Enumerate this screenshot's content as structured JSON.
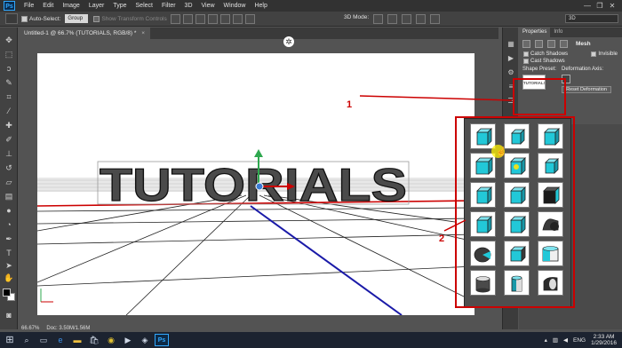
{
  "app": {
    "logo_text": "Ps",
    "menu": [
      "File",
      "Edit",
      "Image",
      "Layer",
      "Type",
      "Select",
      "Filter",
      "3D",
      "View",
      "Window",
      "Help"
    ],
    "window_controls": [
      "—",
      "❐",
      "✕"
    ]
  },
  "options_bar": {
    "auto_select_label": "Auto-Select:",
    "auto_select_value": "Group",
    "show_transform_label": "Show Transform Controls",
    "mode_3d_label": "3D Mode:",
    "workspace_value": "3D"
  },
  "document": {
    "tab_title": "Untitled-1 @ 66.7% (TUTORIALS, RGB/8) *",
    "tab_close": "×",
    "text_3d": "TUTORIALS",
    "zoom": "66.67%",
    "doc_size": "Doc: 3.50M/1.56M"
  },
  "properties": {
    "tabs": [
      "Properties",
      "Info"
    ],
    "mesh_label": "Mesh",
    "catch_shadows_label": "Catch Shadows",
    "invisible_label": "Invisible",
    "cast_shadows_label": "Cast Shadows",
    "shape_preset_label": "Shape Preset:",
    "shape_thumb_text": "TUTORIALS",
    "deformation_axis_label": "Deformation Axis:",
    "reset_deformation_label": "Reset Deformation"
  },
  "annotations": {
    "one": "1",
    "two": "2",
    "color": "#cc0000"
  },
  "taskbar": {
    "language": "ENG",
    "time": "2:33 AM",
    "date": "1/29/2016"
  }
}
